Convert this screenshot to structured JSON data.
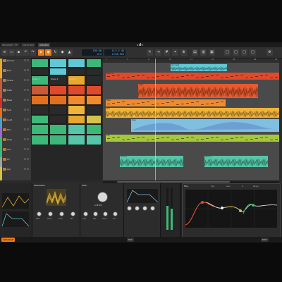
{
  "tabs": [
    "Whywise4 T9*",
    "Generator",
    "Untitled"
  ],
  "toolbar": {
    "tempo": "130.00",
    "signature": "4/4",
    "position": "8.3.2.46",
    "time": "0:56.923",
    "arranger_label": "Arranger"
  },
  "tracks": [
    {
      "name": "Drums",
      "color": "#e6a82f"
    },
    {
      "name": "Kick",
      "color": "#e6a82f"
    },
    {
      "name": "Snare",
      "color": "#c85a3a"
    },
    {
      "name": "Hats",
      "color": "#c85a3a"
    },
    {
      "name": "Bass",
      "color": "#d03030"
    },
    {
      "name": "Sub",
      "color": "#e07020"
    },
    {
      "name": "Lead",
      "color": "#4aa0c8"
    },
    {
      "name": "Pad",
      "color": "#9b6ad1"
    },
    {
      "name": "Keys",
      "color": "#3cb878"
    },
    {
      "name": "Vox",
      "color": "#3cb878"
    },
    {
      "name": "FX",
      "color": "#a0a0a0"
    },
    {
      "name": "Arp",
      "color": "#d4c24a"
    }
  ],
  "scenes": [
    "Scene 1",
    "Scene 2",
    "Scene 3"
  ],
  "ruler": [
    "1",
    "5",
    "9",
    "13",
    "17",
    "21",
    "25",
    "29",
    "33"
  ],
  "arranger_clips": [
    {
      "label": "Vox Lead",
      "color": "#5fc9d6"
    },
    {
      "label": "Bass Ch",
      "color": "#e04a2c"
    },
    {
      "label": "Lead",
      "color": "#e85a2e"
    },
    {
      "label": "Bass",
      "color": "#f08a2e"
    },
    {
      "label": "Pad",
      "color": "#f0b43a"
    },
    {
      "label": "Keys",
      "color": "#7fbfe0"
    },
    {
      "label": "Arp",
      "color": "#a5c83a"
    },
    {
      "label": "Vocal 1",
      "color": "#55c6a8"
    },
    {
      "label": "Vocal 2",
      "color": "#55c6a8"
    }
  ],
  "devices": {
    "synth_title": "Wavetable",
    "synth_knobs": [
      "Pitch",
      "Glide",
      "Time",
      "Mix"
    ],
    "filter_title": "Filter",
    "filter_value": "4.36 kHz",
    "filter_knobs": [
      "Freq",
      "Res",
      "Drive",
      "Env"
    ],
    "eq_title": "EQ+",
    "eq_bands": [
      "Freq",
      "Gain",
      "Q",
      "Range"
    ]
  },
  "status": {
    "left": "ARRANGE",
    "center": "MIX",
    "right": "EDIT"
  }
}
